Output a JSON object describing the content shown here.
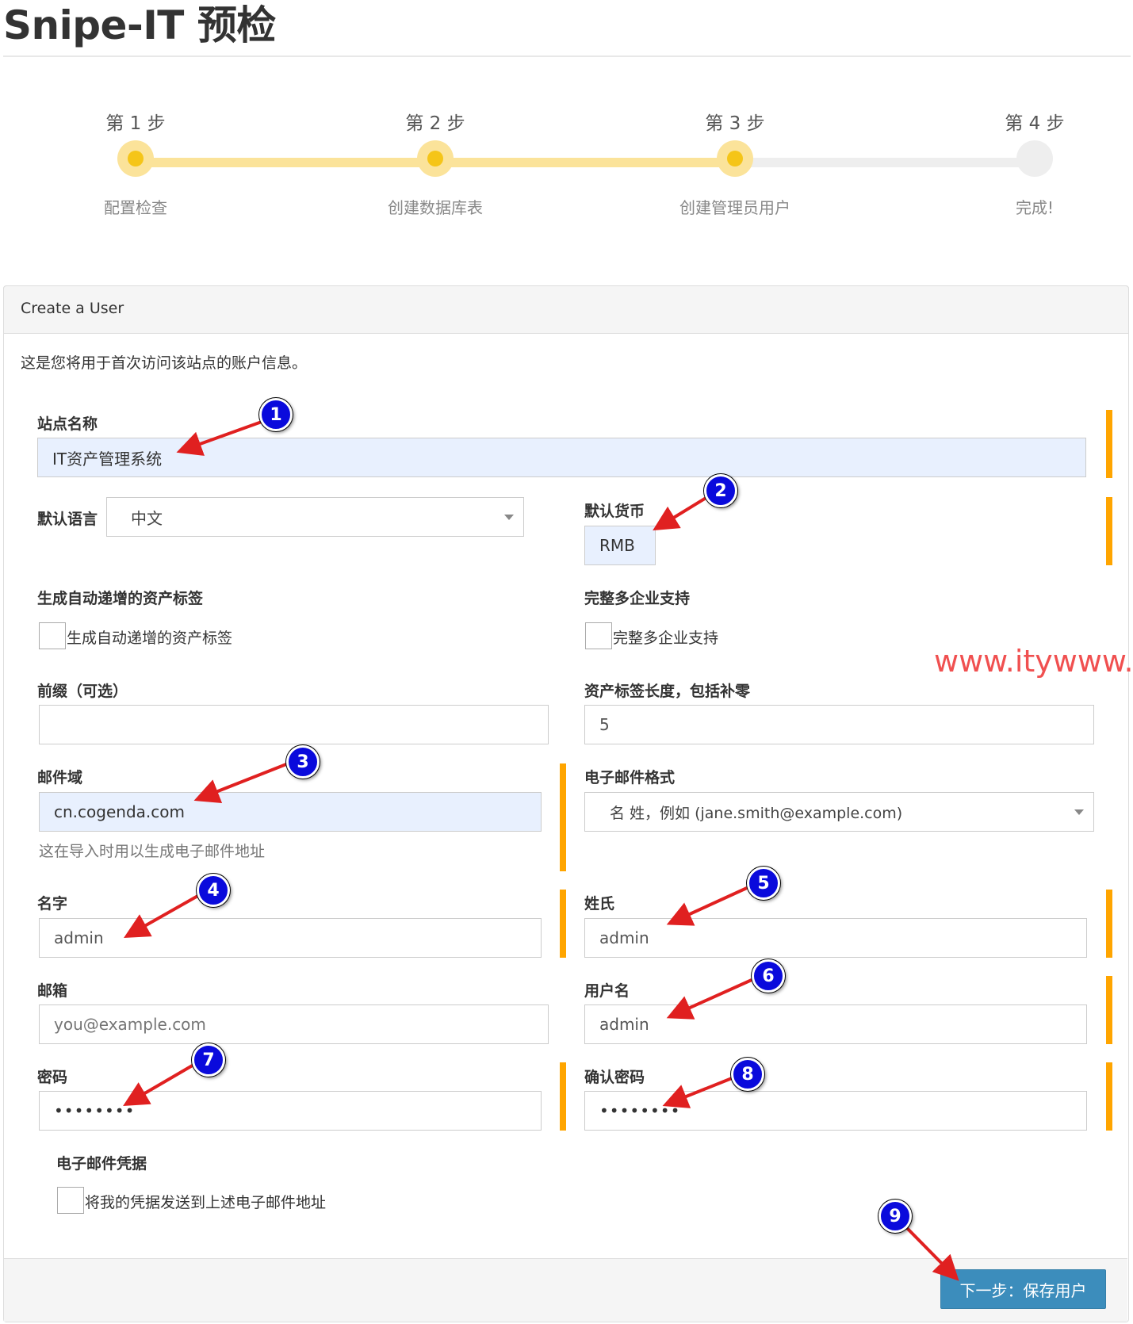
{
  "page": {
    "title": "Snipe-IT 预检"
  },
  "steps": [
    {
      "step": "第 1 步",
      "label": "配置检查",
      "state": "done"
    },
    {
      "step": "第 2 步",
      "label": "创建数据库表",
      "state": "done"
    },
    {
      "step": "第 3 步",
      "label": "创建管理员用户",
      "state": "done"
    },
    {
      "step": "第 4 步",
      "label": "完成!",
      "state": "todo"
    }
  ],
  "panel": {
    "title": "Create a User",
    "intro": "这是您将用于首次访问该站点的账户信息。"
  },
  "form": {
    "site_name": {
      "label": "站点名称",
      "value": "IT资产管理系统"
    },
    "language": {
      "label": "默认语言",
      "value": "中文"
    },
    "currency": {
      "label": "默认货币",
      "value": "RMB"
    },
    "auto_increment": {
      "label": "生成自动递增的资产标签",
      "checkbox_label": "生成自动递增的资产标签"
    },
    "multi_company": {
      "label": "完整多企业支持",
      "checkbox_label": "完整多企业支持"
    },
    "prefix": {
      "label": "前缀（可选）",
      "value": ""
    },
    "tag_length": {
      "label": "资产标签长度，包括补零",
      "value": "5"
    },
    "email_domain": {
      "label": "邮件域",
      "value": "cn.cogenda.com",
      "hint": "这在导入时用以生成电子邮件地址"
    },
    "email_format": {
      "label": "电子邮件格式",
      "value": "名 姓，例如 (jane.smith@example.com)"
    },
    "first_name": {
      "label": "名字",
      "value": "admin"
    },
    "last_name": {
      "label": "姓氏",
      "value": "admin"
    },
    "email": {
      "label": "邮箱",
      "placeholder": "you@example.com"
    },
    "username": {
      "label": "用户名",
      "value": "admin"
    },
    "password": {
      "label": "密码",
      "value": "••••••••"
    },
    "confirm_password": {
      "label": "确认密码",
      "value": "••••••••"
    },
    "email_credentials": {
      "label": "电子邮件凭据",
      "checkbox_label": "将我的凭据发送到上述电子邮件地址"
    }
  },
  "footer": {
    "submit_label": "下一步：保存用户"
  },
  "watermark": "www.itywww.cn",
  "annotations": [
    "1",
    "2",
    "3",
    "4",
    "5",
    "6",
    "7",
    "8",
    "9"
  ],
  "colors": {
    "accent": "#3c8dbc",
    "step_done": "#f5c518",
    "required_bar": "#ffa500",
    "annotation_badge": "#0a0adc",
    "annotation_arrow": "#e02020"
  }
}
